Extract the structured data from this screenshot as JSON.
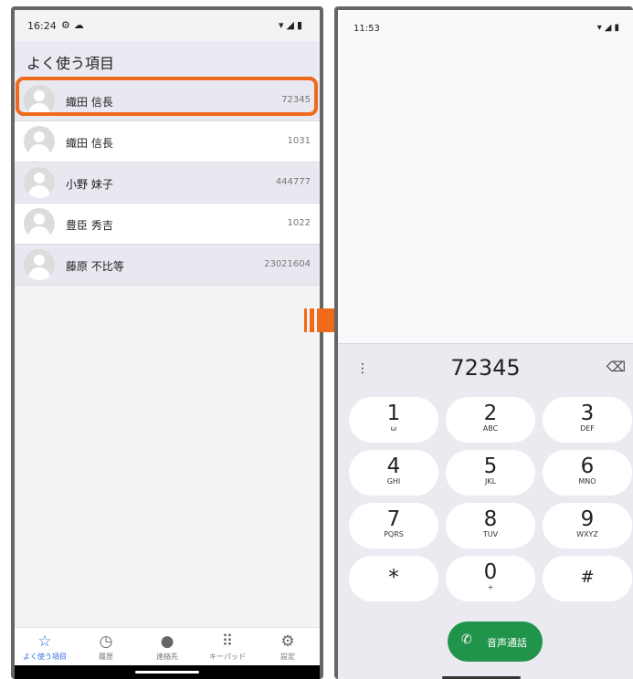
{
  "left_screen": {
    "status": {
      "time": "16:24",
      "left_icons": [
        "settings-sync-icon",
        "cloud-icon"
      ],
      "right_icons": [
        "wifi-icon",
        "signal-icon",
        "battery-icon"
      ]
    },
    "header": {
      "title": "よく使う項目"
    },
    "contacts": [
      {
        "name": "織田 信長",
        "number": "72345"
      },
      {
        "name": "織田 信長",
        "number": "1031"
      },
      {
        "name": "小野 妹子",
        "number": "444777"
      },
      {
        "name": "豊臣 秀吉",
        "number": "1022"
      },
      {
        "name": "藤原 不比等",
        "number": "23021604"
      }
    ],
    "bottom_nav": [
      {
        "label": "よく使う項目",
        "icon": "star-icon",
        "glyph": "☆",
        "active": true
      },
      {
        "label": "履歴",
        "icon": "history-icon",
        "glyph": "◷",
        "active": false
      },
      {
        "label": "連絡先",
        "icon": "person-icon",
        "glyph": "●",
        "active": false
      },
      {
        "label": "キーパッド",
        "icon": "keypad-icon",
        "glyph": "⠿",
        "active": false
      },
      {
        "label": "設定",
        "icon": "gear-icon",
        "glyph": "⚙",
        "active": false
      }
    ]
  },
  "right_screen": {
    "status": {
      "time": "11:53",
      "right_icons": [
        "wifi-icon",
        "signal-icon",
        "battery-icon"
      ]
    },
    "dialer": {
      "number": "72345",
      "keys": [
        {
          "digit": "1",
          "letters": "ω"
        },
        {
          "digit": "2",
          "letters": "ABC"
        },
        {
          "digit": "3",
          "letters": "DEF"
        },
        {
          "digit": "4",
          "letters": "GHI"
        },
        {
          "digit": "5",
          "letters": "JKL"
        },
        {
          "digit": "6",
          "letters": "MNO"
        },
        {
          "digit": "7",
          "letters": "PQRS"
        },
        {
          "digit": "8",
          "letters": "TUV"
        },
        {
          "digit": "9",
          "letters": "WXYZ"
        },
        {
          "digit": "*",
          "letters": ""
        },
        {
          "digit": "0",
          "letters": "+"
        },
        {
          "digit": "#",
          "letters": ""
        }
      ],
      "call_label": "音声通話"
    }
  },
  "colors": {
    "highlight": "#f06a1c",
    "arrow": "#f06a1c",
    "active_nav": "#2d6fe0",
    "call_button": "#21944b"
  }
}
